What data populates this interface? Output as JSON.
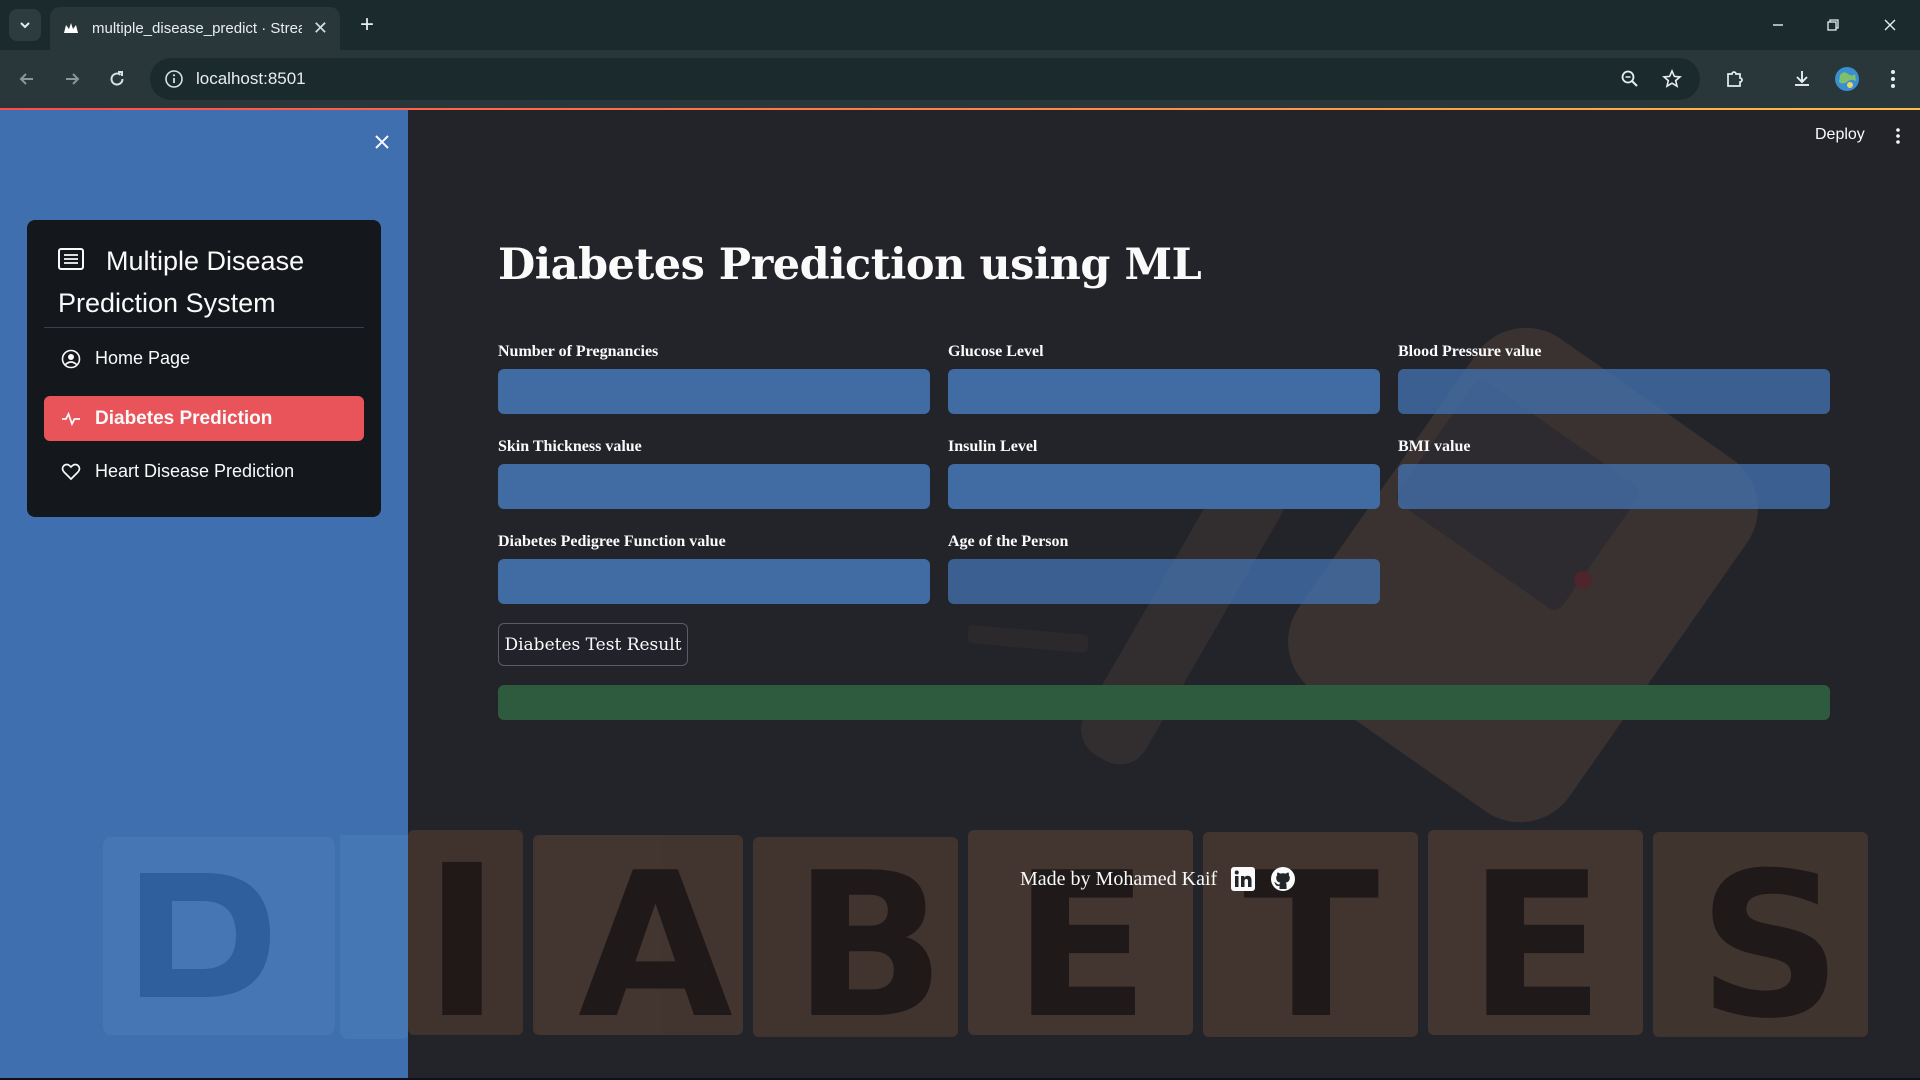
{
  "browser": {
    "tab_title": "multiple_disease_predict · Streamlit",
    "url": "localhost:8501"
  },
  "app": {
    "deploy_label": "Deploy"
  },
  "sidebar": {
    "menu_title": "Multiple Disease Prediction System",
    "items": [
      {
        "label": "Home Page",
        "icon": "person-circle-icon",
        "active": false
      },
      {
        "label": "Diabetes Prediction",
        "icon": "activity-icon",
        "active": true
      },
      {
        "label": "Heart Disease Prediction",
        "icon": "heart-icon",
        "active": false
      }
    ],
    "accent_color": "#e9545a",
    "background_color": "#3f6fae"
  },
  "main": {
    "title": "Diabetes Prediction using ML",
    "fields": [
      {
        "label": "Number of Pregnancies",
        "value": ""
      },
      {
        "label": "Glucose Level",
        "value": ""
      },
      {
        "label": "Blood Pressure value",
        "value": ""
      },
      {
        "label": "Skin Thickness value",
        "value": ""
      },
      {
        "label": "Insulin Level",
        "value": ""
      },
      {
        "label": "BMI value",
        "value": ""
      },
      {
        "label": "Diabetes Pedigree Function value",
        "value": ""
      },
      {
        "label": "Age of the Person",
        "value": ""
      }
    ],
    "button_label": "Diabetes Test Result",
    "result_text": "",
    "result_color": "#2e5a3e",
    "background_word": "DIABETES",
    "footer": {
      "text": "Made by Mohamed Kaif",
      "icons": [
        "linkedin-icon",
        "github-icon"
      ]
    }
  }
}
